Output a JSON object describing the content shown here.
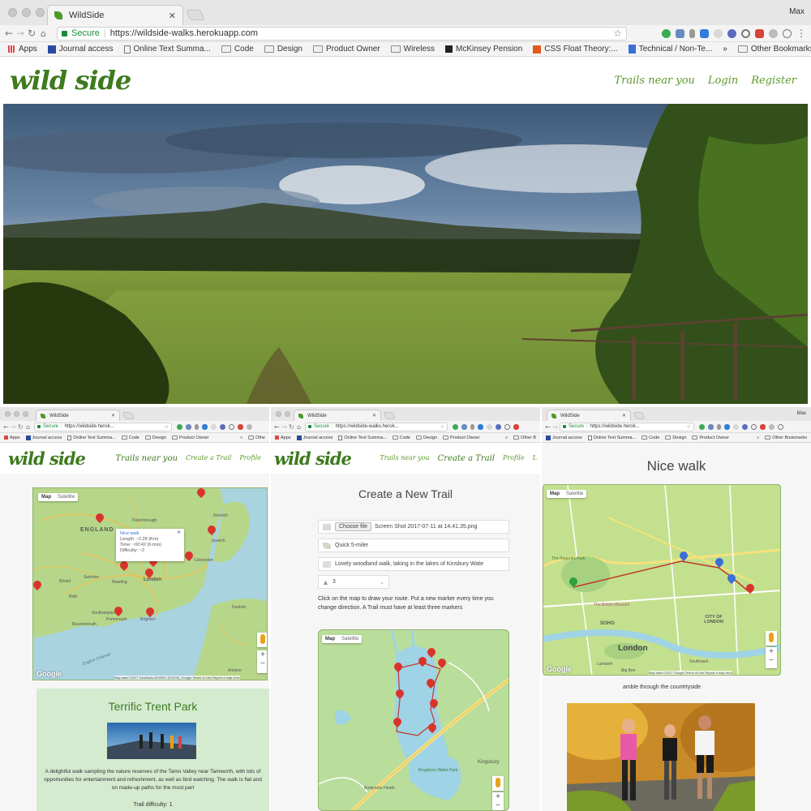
{
  "main": {
    "tab_title": "WildSide",
    "user": "Max",
    "secure_label": "Secure",
    "url": "https://wildside-walks.herokuapp.com",
    "bookmarks": [
      "Apps",
      "Journal access",
      "Online Text Summa...",
      "Code",
      "Design",
      "Product Owner",
      "Wireless",
      "McKinsey Pension",
      "CSS Float Theory:...",
      "Technical / Non-Te..."
    ],
    "bookmarks_overflow": "»",
    "other_bookmarks": "Other Bookmarks",
    "logo": "wild side",
    "nav": [
      "Trails near you",
      "Login",
      "Register"
    ]
  },
  "left": {
    "tab_title": "WildSide",
    "secure_label": "Secure",
    "url": "https://wildside.herok...",
    "bookmarks": [
      "Apps",
      "Journal access",
      "Online Text Summa...",
      "Code",
      "Design",
      "Product Owner"
    ],
    "bookmarks_overflow": "»",
    "other_bookmarks": "Othe",
    "logo": "wild side",
    "nav": [
      "Trails near you",
      "Create a Trail",
      "Profile"
    ],
    "map": {
      "type_map": "Map",
      "type_sat": "Satellite",
      "labels": [
        "ENGLAND",
        "Norwich",
        "Peterborough",
        "Swindon",
        "Reading",
        "London",
        "Bristol",
        "Bath",
        "Southampton",
        "Portsmouth",
        "Brighton",
        "Bournemouth",
        "Ipswich",
        "Colchester",
        "Dunkirk",
        "Amiens",
        "English Channel"
      ],
      "popup_title": "Nice walk",
      "popup_lines": [
        "Length: ~2.28 (Km)",
        "Time: ~00:42 (h:mm)",
        "Difficulty: ~2"
      ],
      "google": "Google",
      "footer": "Map data ©2017 GeoBasis-DE/BKG (©2009), Google   Terms of Use   Report a map error"
    },
    "card": {
      "title": "Terrific Trent Park",
      "description": "A delightful walk sampling the nature reserves of the Tamo Valley near Tamworth, with lots of opportunities for entertainment and refreshment, as well as bird watching. The walk is flat and on made-up paths for the most part",
      "difficulty": "Trail difficulty: 1"
    }
  },
  "middle": {
    "tab_title": "WildSide",
    "secure_label": "Secure",
    "url": "https://wildside-walks.herok...",
    "bookmarks": [
      "Apps",
      "Journal access",
      "Online Text Summa...",
      "Code",
      "Design",
      "Product Owner"
    ],
    "bookmarks_overflow": "»",
    "other_bookmarks": "Other B",
    "logo": "wild side",
    "nav": [
      "Trails near you",
      "Create a Trail",
      "Profile",
      "L"
    ],
    "heading": "Create a New Trail",
    "choose_file": "Choose file",
    "file_name": "Screen Shot 2017-07-11 at 14.41.35.png",
    "name_value": "Quick 5-miler",
    "desc_value": "Lovely woodland walk, taking in the lakes of Kinsbury Wate",
    "difficulty_value": "3",
    "instructions": "Click on the map to draw your route. Put a new marker every time you change direction. A Trail must have at least three markers",
    "map": {
      "type_map": "Map",
      "type_sat": "Satellite",
      "labels": [
        "Kingsbury",
        "Kingsbury Water Park",
        "Bodymoor Heath"
      ]
    }
  },
  "right": {
    "tab_title": "WildSide",
    "user": "Max",
    "secure_label": "Secure",
    "url": "https://wildside.herok...",
    "bookmarks": [
      "Journal access",
      "Online Text Summa...",
      "Code",
      "Design",
      "Product Owner"
    ],
    "bookmarks_overflow": "»",
    "other_bookmarks": "Other Bookmarks",
    "heading": "Nice walk",
    "map": {
      "type_map": "Map",
      "type_sat": "Satellite",
      "labels": [
        "The Regent's Park",
        "London",
        "SOHO",
        "CITY OF LONDON",
        "The British Museum",
        "Southwark",
        "Big Ben",
        "Lambeth"
      ],
      "google": "Google",
      "footer": "Map data ©2017 Google   Terms of Use   Report a map error"
    },
    "caption": "amble through the countrtyside"
  }
}
